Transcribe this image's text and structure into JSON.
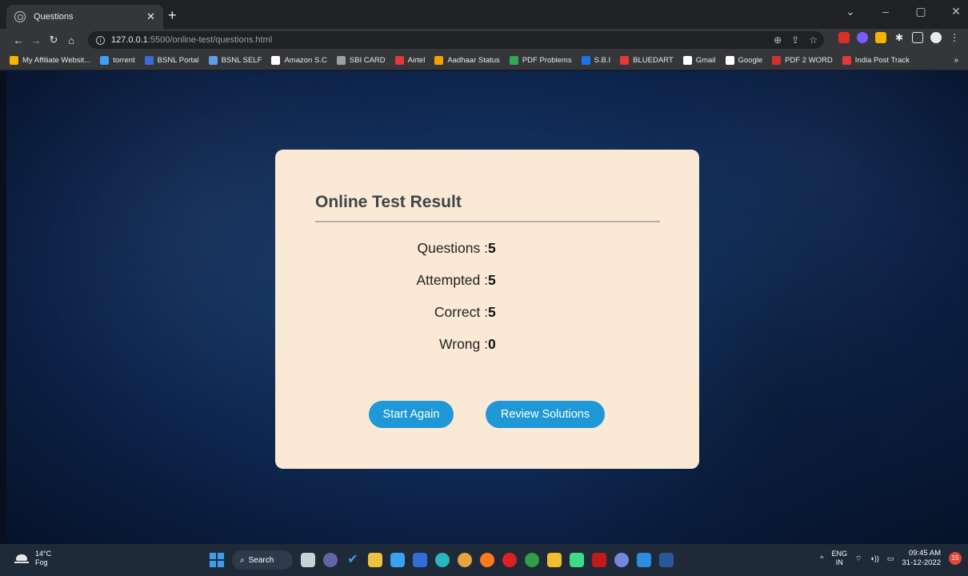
{
  "browser": {
    "tab_title": "Questions",
    "url_host": "127.0.0.1",
    "url_path": ":5500/online-test/questions.html",
    "bookmarks": [
      {
        "label": "My Affiliate Websit...",
        "color": "#f4b400"
      },
      {
        "label": "torrent",
        "color": "#3aa0f0"
      },
      {
        "label": "BSNL Portal",
        "color": "#3b6bd6"
      },
      {
        "label": "BSNL SELF",
        "color": "#5f9ee0"
      },
      {
        "label": "Amazon S.C",
        "color": "#ffffff"
      },
      {
        "label": "SBI CARD",
        "color": "#9aa0a6"
      },
      {
        "label": "Airtel",
        "color": "#e53935"
      },
      {
        "label": "Aadhaar Status",
        "color": "#f4a100"
      },
      {
        "label": "PDF Problems",
        "color": "#34a853"
      },
      {
        "label": "S.B.I",
        "color": "#1a73e8"
      },
      {
        "label": "BLUEDART",
        "color": "#e53935"
      },
      {
        "label": "Gmail",
        "color": "#ffffff"
      },
      {
        "label": "Google",
        "color": "#ffffff"
      },
      {
        "label": "PDF 2 WORD",
        "color": "#d32f2f"
      },
      {
        "label": "India Post Track",
        "color": "#e53935"
      }
    ],
    "more_bookmarks": "»"
  },
  "result": {
    "title": "Online Test Result",
    "stats": [
      {
        "label": "Questions :",
        "value": "5"
      },
      {
        "label": "Attempted :",
        "value": "5"
      },
      {
        "label": "Correct :",
        "value": "5"
      },
      {
        "label": "Wrong :",
        "value": "0"
      }
    ],
    "start_again_label": "Start Again",
    "review_solutions_label": "Review Solutions"
  },
  "taskbar": {
    "temperature": "14°C",
    "weather": "Fog",
    "search_label": "Search",
    "lang_top": "ENG",
    "lang_bottom": "IN",
    "time": "09:45 AM",
    "date": "31-12-2022",
    "notification_count": "15"
  },
  "colors": {
    "card_bg": "#fae9d5",
    "button_bg": "#1e98d6",
    "page_bg": "#12305c"
  }
}
